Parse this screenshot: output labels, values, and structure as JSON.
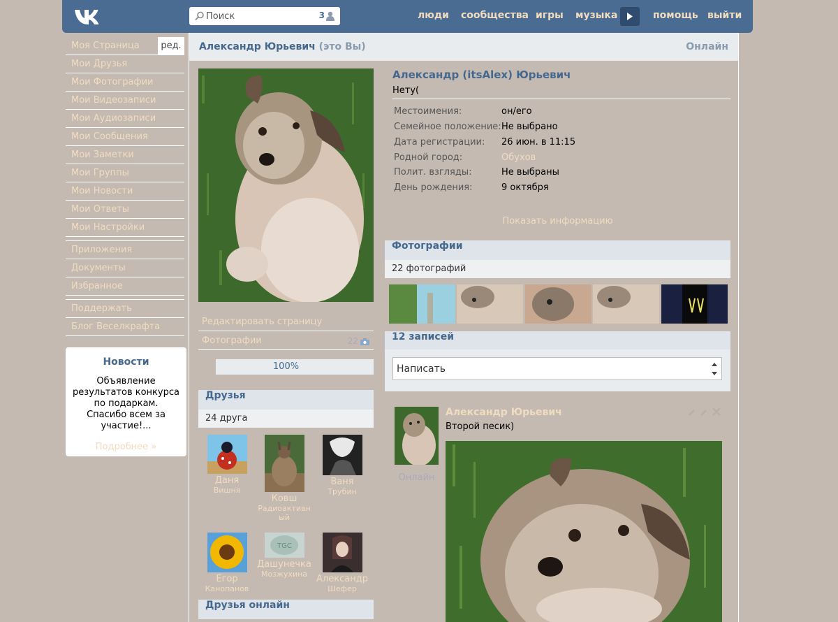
{
  "header": {
    "search_placeholder": "Поиск",
    "search_count": "3",
    "nav": [
      "люди",
      "сообщества",
      "игры",
      "музыка",
      "помощь",
      "выйти"
    ]
  },
  "left_menu": {
    "items_top": [
      "Моя Страница",
      "Мои Друзья",
      "Мои Фотографии",
      "Мои Видеозаписи",
      "Мои Аудиозаписи",
      "Мои Сообщения",
      "Мои Заметки",
      "Мои Группы",
      "Мои Новости",
      "Мои Ответы",
      "Мои Настройки"
    ],
    "edit_label": "ред.",
    "items_mid": [
      "Приложения",
      "Документы",
      "Избранное"
    ],
    "items_bottom": [
      "Поддержать",
      "Блог Веселкрафта"
    ],
    "news": {
      "title": "Новости",
      "text": "Объявление результатов конкурса по подаркам. Спасибо всем за участие!...",
      "more": "Подробнее »"
    }
  },
  "profile": {
    "head_name": "Александр Юрьевич",
    "head_me": "(это Вы)",
    "head_online": "Онлайн",
    "full_name": "Александр (itsAlex) Юрьевич",
    "status": "Нету(",
    "info": [
      {
        "k": "Местоимения:",
        "v": "он/его"
      },
      {
        "k": "Семейное положение:",
        "v": "Не выбрано"
      },
      {
        "k": "Дата регистрации:",
        "v": "26 июн. в 11:15"
      },
      {
        "k": "Родной город:",
        "v": "Обухов"
      },
      {
        "k": "Полит. взгляды:",
        "v": "Не выбраны"
      },
      {
        "k": "День рождения:",
        "v": "9 октября"
      }
    ],
    "show_info": "Показать информацию",
    "edit_page": "Редактировать страницу",
    "photos_link": "Фотографии",
    "photos_count": "22",
    "progress_label": "100%",
    "progress_fraction": 0.1
  },
  "friends": {
    "title": "Друзья",
    "count": "24 друга",
    "list": [
      {
        "first": "Даня",
        "last": "Вишня"
      },
      {
        "first": "Ковш",
        "last": "Радиоактивный"
      },
      {
        "first": "Ваня",
        "last": "Трубин"
      },
      {
        "first": "Егор",
        "last": "Канопанов"
      },
      {
        "first": "Дашунечка",
        "last": "Мозжухина"
      },
      {
        "first": "Александр",
        "last": "Шефер"
      }
    ],
    "online_title": "Друзья онлайн"
  },
  "photos": {
    "title": "Фотографии",
    "count": "22 фотографий"
  },
  "wall": {
    "title": "12 записей",
    "placeholder": "Написать",
    "post": {
      "author": "Александр Юрьевич",
      "text": "Второй песик)",
      "online": "Онлайн"
    }
  }
}
